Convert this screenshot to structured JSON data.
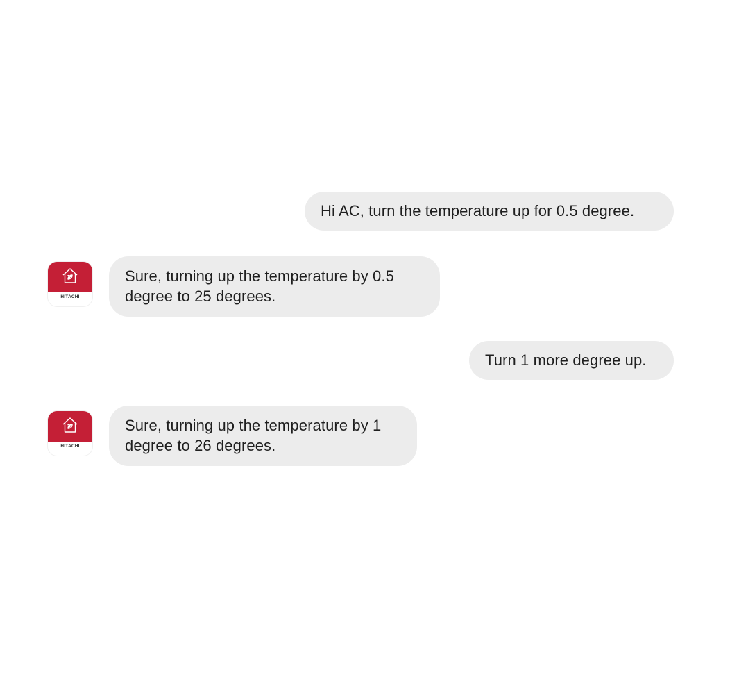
{
  "conversation": {
    "messages": [
      {
        "role": "user",
        "text": "Hi AC, turn the temperature up for 0.5 degree."
      },
      {
        "role": "assistant",
        "avatar": {
          "icon": "hitachi-home-icon",
          "brand": "HITACHI"
        },
        "lines": [
          "Sure, turning up the temperature by 0.5",
          "degree to 25 degrees."
        ]
      },
      {
        "role": "user",
        "text": "Turn 1 more degree up."
      },
      {
        "role": "assistant",
        "avatar": {
          "icon": "hitachi-home-icon",
          "brand": "HITACHI"
        },
        "lines": [
          "Sure, turning up the temperature by 1",
          "degree to 26 degrees."
        ]
      }
    ]
  },
  "colors": {
    "bubble_background": "#ececec",
    "brand_red": "#c41f36",
    "text": "#1f1f1f",
    "page_background": "#ffffff"
  }
}
